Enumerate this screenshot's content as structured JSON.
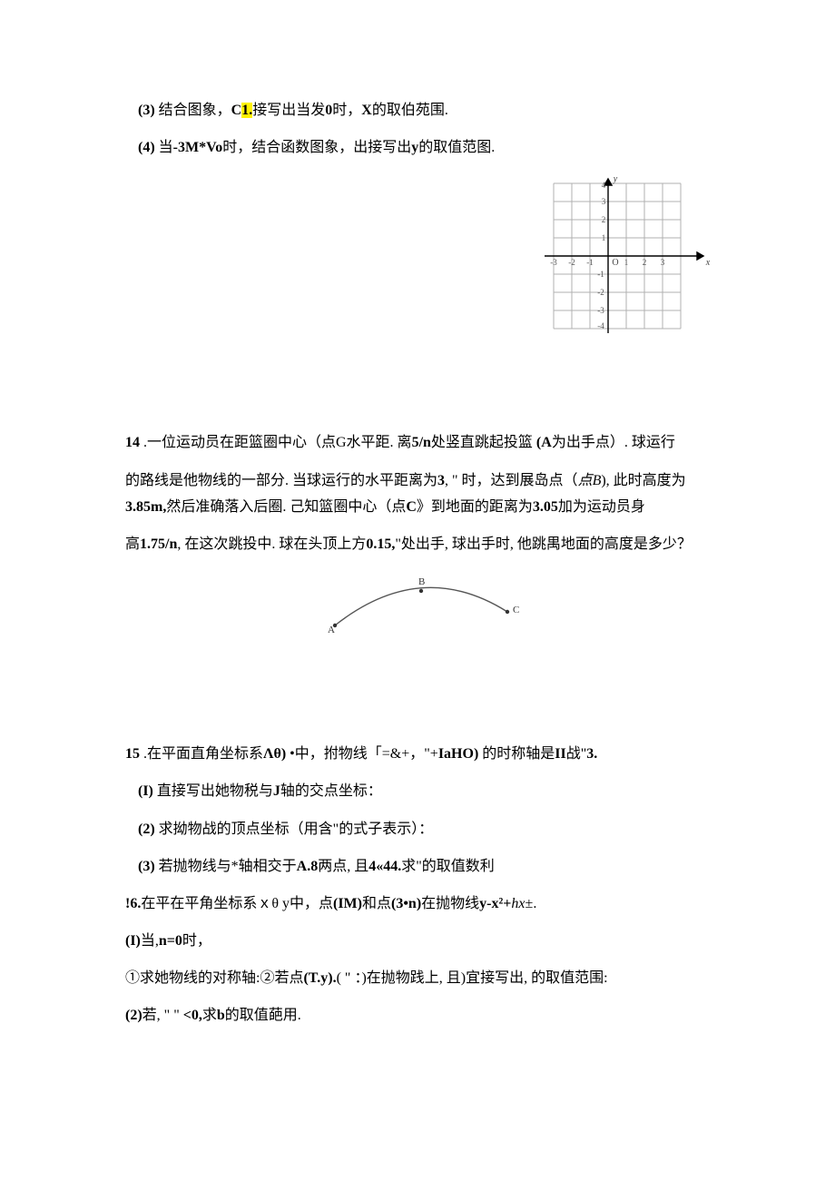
{
  "p3": {
    "label": "(3)",
    "text_a": "结合图象，",
    "c": "C",
    "one": "1.",
    "text_b": "接写出当发",
    "zero": "0",
    "text_c": "时，",
    "x": "X",
    "text_d": "的取伯苑围."
  },
  "p4": {
    "label": "(4)",
    "text_a": "当",
    "expr": "-3M*Vo",
    "text_b": "时，结合函数图象，出接写出",
    "y": "y",
    "text_c": "的取值范图."
  },
  "q14": {
    "num": "14",
    "line1_a": " .一位运动员在距篮圈中心（点G水平距. 离",
    "line1_b": "5/n",
    "line1_c": "处竖直跳起投篮 ",
    "line1_d": "(A",
    "line1_e": "为出手点）. 球运行",
    "line2_a": "的路线是他物线的一部分. 当球运行的水平距离为",
    "line2_b": "3",
    "line2_c": ", \" 时，达到展岛点（",
    "line2_d": "点B",
    "line2_e": "), 此时高度为",
    "line3_a": "3.85m,",
    "line3_b": "然后准确落入后圈. 己知篮圈中心（点",
    "line3_c": "C",
    "line3_d": "》到地面的距离为",
    "line3_e": "3.05",
    "line3_f": "加为运动员身",
    "line4_a": "高",
    "line4_b": "1.75/n",
    "line4_c": ", 在这次跳投中. 球在头顶上方",
    "line4_d": "0.15,",
    "line4_e": "\"处出手, 球出手时, 他跳禺地面的高度是多少？"
  },
  "arc": {
    "A": "A",
    "B": "B",
    "C": "C"
  },
  "q15": {
    "num": "15",
    "line1": " .在平面直角坐标系",
    "line1_b": "Λθ)",
    "line1_c": " •中，拊物线「=&+，\"+",
    "line1_d": "IaHO)",
    "line1_e": " 的时称轴是",
    "line1_f": "II",
    "line1_g": "战\"",
    "line1_h": "3.",
    "s1_label": "(I)",
    "s1_text": "直接写出她物税与",
    "s1_J": "J",
    "s1_text2": "轴的交点坐标：",
    "s2_label": "(2)",
    "s2_text": "求拗物战的顶点坐标（用含\"的式子表示）：",
    "s3_label": "(3)",
    "s3_text_a": "若抛物线与*轴相交于",
    "s3_text_b": "A.8",
    "s3_text_c": "两点, 且",
    "s3_text_d": "4«44.",
    "s3_text_e": "求\"的取值数利"
  },
  "q16": {
    "head_a": "!6.",
    "head_b": "在平在平角坐标系ｘθ y中，点",
    "head_c": "(IM)",
    "head_d": "和点",
    "head_e": "(3•n)",
    "head_f": "在抛物线",
    "head_g": "y-x²+",
    "head_h": "hx",
    "head_i": "±.",
    "s1_label": "(I)",
    "s1_text_a": "当,",
    "s1_text_b": "n=0",
    "s1_text_c": "时，",
    "s2_a": "①求她物线的对称轴:②若点",
    "s2_b": "(T.y).",
    "s2_c": "( \" ：)在抛物践上, 且)宜接写出, 的取值范围:",
    "s3_label": "(2)",
    "s3_a": "若, \" \" ",
    "s3_b": "<0,",
    "s3_c": "求",
    "s3_d": "b",
    "s3_e": "的取值葩用."
  },
  "grid": {
    "xlabel": "x",
    "ylabel": "y",
    "xticks": [
      "-3",
      "-2",
      "-1",
      "1",
      "2",
      "3"
    ],
    "yticks_pos": [
      "1",
      "2",
      "3",
      "4"
    ],
    "yticks_neg": [
      "-1",
      "-2",
      "-3",
      "-4"
    ],
    "origin": "O"
  }
}
